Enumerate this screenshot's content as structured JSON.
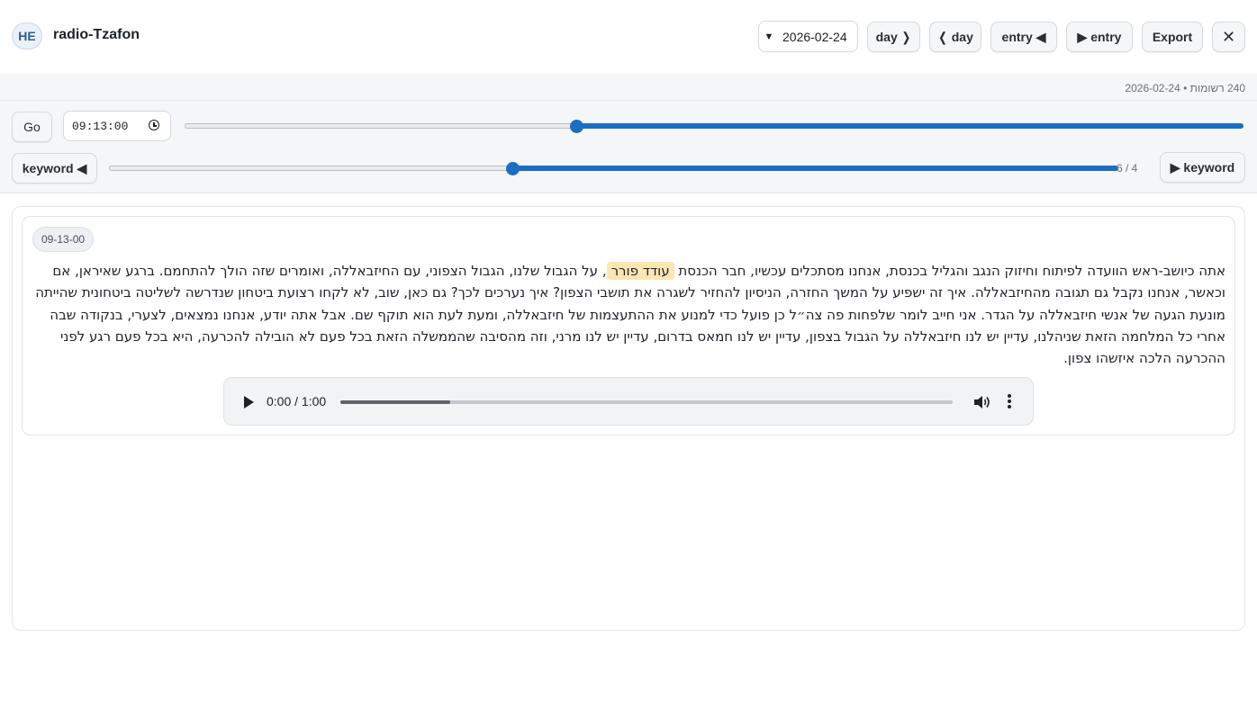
{
  "header": {
    "lang_badge": "HE",
    "app_title": "radio-Tzafon",
    "date_value": "2026-02-24",
    "buttons": {
      "next_day": "day ❭",
      "prev_day": "❬ day",
      "prev_entry": "entry ◀",
      "next_entry": "▶ entry",
      "export": "Export",
      "close": "✕"
    }
  },
  "info": {
    "summary": "240 רשומות • 2026-02-24"
  },
  "controls": {
    "go_label": "Go",
    "time_value": "09:13:00 ",
    "time_slider_fraction": 0.37,
    "prev_keyword": "keyword ◀",
    "next_keyword": "▶ keyword",
    "keyword_counter": "6 / 4",
    "keyword_slider_fraction": 0.4
  },
  "entry": {
    "time": "09-13-00",
    "text_before": "אתה כיושב-ראש הוועדה לפיתוח וחיזוק הנגב והגליל בכנסת, אנחנו מסתכלים עכשיו, חבר הכנסת ",
    "highlight": "עודד פורר",
    "text_after": ", על הגבול שלנו, הגבול הצפוני, עם החיזבאללה, ואומרים שזה הולך להתחמם. ברגע שאיראן, אם וכאשר, אנחנו נקבל גם תגובה מהחיזבאללה. איך זה ישפיע על המשך החזרה, הניסיון להחזיר לשגרה את תושבי הצפון? איך נערכים לכך? גם כאן, שוב, לא לקחו רצועת ביטחון שנדרשה לשליטה ביטחונית שהייתה מונעת הגעה של אנשי חיזבאללה על הגדר. אני חייב לומר שלפחות פה צה״ל כן פועל כדי למנוע את ההתעצמות של חיזבאללה, ומעת לעת הוא תוקף שם. אבל אתה יודע, אנחנו נמצאים, לצערי, בנקודה שבה אחרי כל המלחמה הזאת שניהלנו, עדיין יש לנו חיזבאללה על הגבול בצפון, עדיין יש לנו חמאס בדרום, עדיין יש לנו מרני, וזה מהסיבה שהממשלה הזאת בכל פעם לא הובילה להכרעה, היא בכל פעם רגע לפני ההכרעה הלכה איזשהו צפון.",
    "player": {
      "time_display": "0:00 / 1:00",
      "buffered_fraction": 0.18
    }
  }
}
